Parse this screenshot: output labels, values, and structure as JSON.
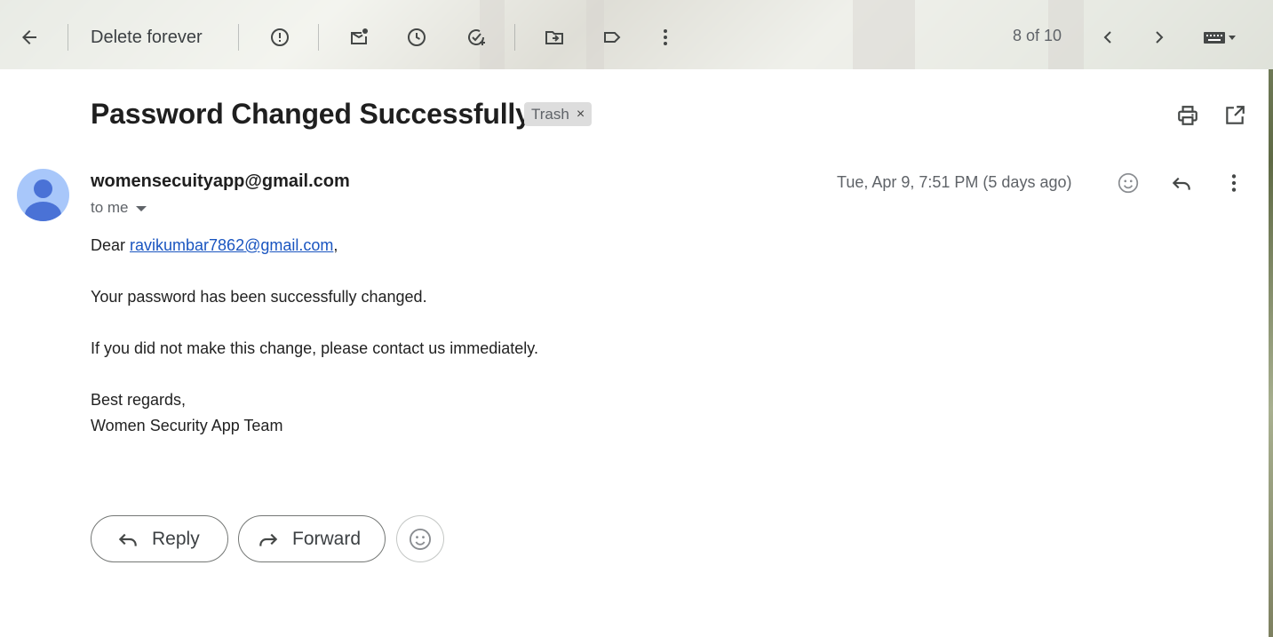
{
  "toolbar": {
    "delete_forever_label": "Delete forever",
    "pager": "8 of 10",
    "icons": [
      "back-arrow-icon",
      "report-spam-icon",
      "mark-unread-icon",
      "snooze-icon",
      "add-task-icon",
      "move-to-icon",
      "label-icon",
      "more-vert-icon",
      "prev-icon",
      "next-icon",
      "keyboard-icon"
    ]
  },
  "email": {
    "subject": "Password Changed Successfully",
    "label": "Trash",
    "label_close": "×",
    "sender": "womensecuityapp@gmail.com",
    "recipient": "to me",
    "date": "Tue, Apr 9, 7:51 PM (5 days ago)",
    "body": {
      "greeting_prefix": "Dear ",
      "greeting_link": "ravikumbar7862@gmail.com",
      "greeting_suffix": ",",
      "line1": "Your password has been successfully changed.",
      "line2": "If you did not make this change, please contact us immediately.",
      "closing": "Best regards,",
      "signature": "Women Security App Team"
    }
  },
  "actions": {
    "reply_label": "Reply",
    "forward_label": "Forward"
  },
  "colors": {
    "link": "#1a55c0",
    "avatar_bg": "#a8c7fa",
    "avatar_fg": "#4a72d6",
    "chip_bg": "#dddddd"
  }
}
